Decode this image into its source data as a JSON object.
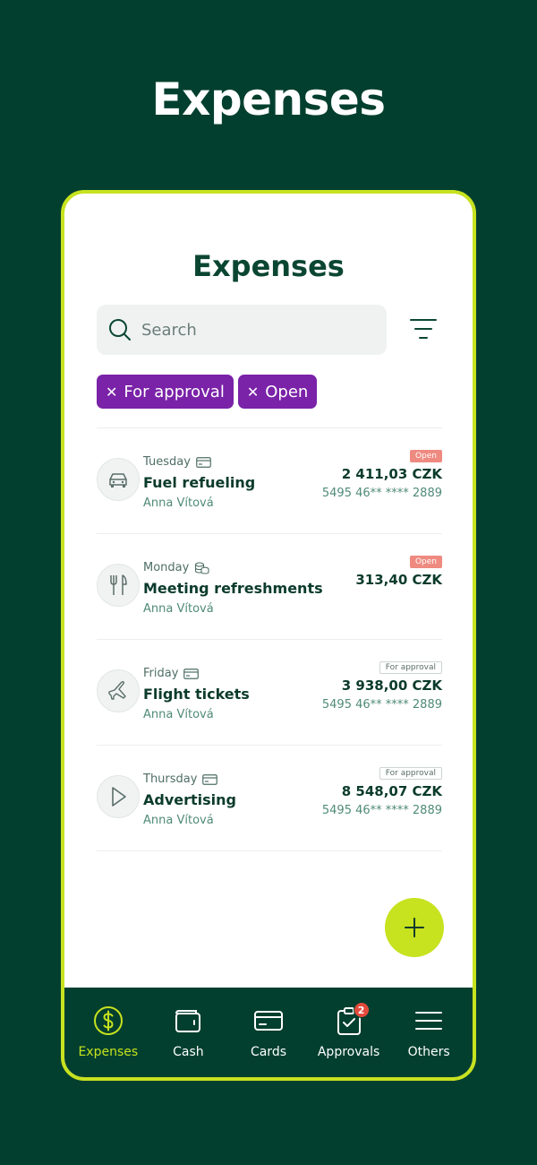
{
  "hero": {
    "title": "Expenses"
  },
  "screen": {
    "title": "Expenses"
  },
  "search": {
    "placeholder": "Search"
  },
  "filters": [
    {
      "label": "For approval"
    },
    {
      "label": "Open"
    }
  ],
  "expenses": [
    {
      "day": "Tuesday",
      "pay_icon": "card-icon",
      "name": "Fuel refueling",
      "person": "Anna Vítová",
      "status": "Open",
      "amount": "2 411,03 CZK",
      "card": "5495 46** **** 2889",
      "icon": "car-icon"
    },
    {
      "day": "Monday",
      "pay_icon": "coins-icon",
      "name": "Meeting refreshments",
      "person": "Anna Vítová",
      "status": "Open",
      "amount": "313,40 CZK",
      "card": "",
      "icon": "cutlery-icon"
    },
    {
      "day": "Friday",
      "pay_icon": "card-icon",
      "name": "Flight tickets",
      "person": "Anna Vítová",
      "status": "For approval",
      "amount": "3 938,00 CZK",
      "card": "5495 46** **** 2889",
      "icon": "airplane-icon"
    },
    {
      "day": "Thursday",
      "pay_icon": "card-icon",
      "name": "Advertising",
      "person": "Anna Vítová",
      "status": "For approval",
      "amount": "8 548,07 CZK",
      "card": "5495 46** **** 2889",
      "icon": "play-icon"
    }
  ],
  "nav": [
    {
      "label": "Expenses",
      "icon": "dollar-circle-icon",
      "active": true
    },
    {
      "label": "Cash",
      "icon": "wallet-icon"
    },
    {
      "label": "Cards",
      "icon": "card-icon"
    },
    {
      "label": "Approvals",
      "icon": "clipboard-check-icon",
      "badge": "2"
    },
    {
      "label": "Others",
      "icon": "menu-icon"
    }
  ],
  "colors": {
    "background": "#023f2e",
    "accent": "#c7e21f",
    "chip": "#7a22a8",
    "open_badge": "#ee8a80",
    "notification": "#e34a3b"
  }
}
